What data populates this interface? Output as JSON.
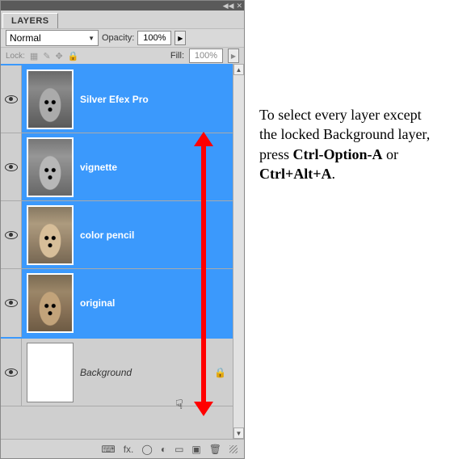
{
  "panel": {
    "title": "LAYERS",
    "blend_mode": "Normal",
    "opacity_label": "Opacity:",
    "opacity_value": "100%",
    "lock_label": "Lock:",
    "fill_label": "Fill:",
    "fill_value": "100%"
  },
  "layers": [
    {
      "name": "Silver Efex Pro",
      "selected": true,
      "visible": true,
      "thumb": "bw",
      "locked": false
    },
    {
      "name": "vignette",
      "selected": true,
      "visible": true,
      "thumb": "vig",
      "locked": false
    },
    {
      "name": "color pencil",
      "selected": true,
      "visible": true,
      "thumb": "pencil",
      "locked": false
    },
    {
      "name": "original",
      "selected": true,
      "visible": true,
      "thumb": "orig",
      "locked": false
    },
    {
      "name": "Background",
      "selected": false,
      "visible": true,
      "thumb": "blank",
      "locked": true
    }
  ],
  "footer_icons": {
    "link": "link-icon",
    "fx": "fx.",
    "mask": "mask-icon",
    "adjust": "adjustment-icon",
    "group": "group-icon",
    "new": "new-layer-icon",
    "trash": "trash-icon"
  },
  "instruction": {
    "line1": "To select every layer except the locked Background layer, press ",
    "shortcut1": "Ctrl-Option-A",
    "or": " or ",
    "shortcut2": "Ctrl+Alt+A",
    "period": "."
  }
}
